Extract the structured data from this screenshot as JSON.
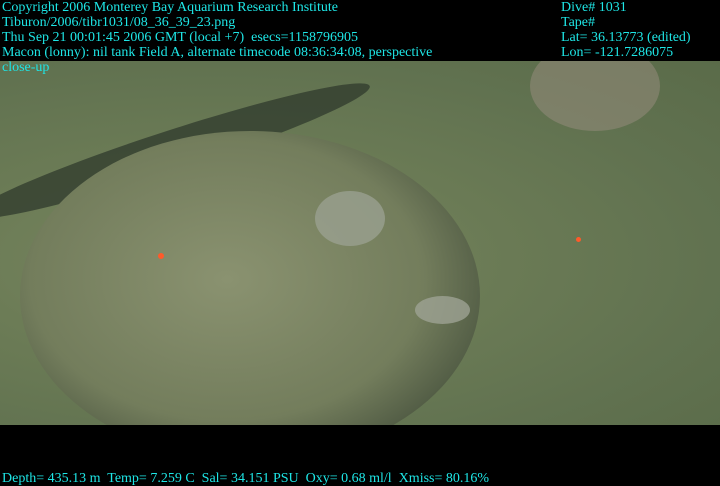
{
  "overlay_top_left": [
    "Copyright 2006 Monterey Bay Aquarium Research Institute",
    "Tiburon/2006/tibr1031/08_36_39_23.png",
    "Thu Sep 21 00:01:45 2006 GMT (local +7)  esecs=1158796905",
    "Macon (lonny): nil tank Field A, alternate timecode 08:36:34:08, perspective",
    "close-up"
  ],
  "overlay_top_right": [
    "Dive# 1031",
    "Tape#",
    "Lat= 36.13773 (edited)",
    "Lon= -121.7286075"
  ],
  "overlay_bottom": "Depth= 435.13 m  Temp= 7.259 C  Sal= 34.151 PSU  Oxy= 0.68 ml/l  Xmiss= 80.16%",
  "colors": {
    "overlay_text": "#1ee6e6",
    "water": "#6c7c56"
  }
}
